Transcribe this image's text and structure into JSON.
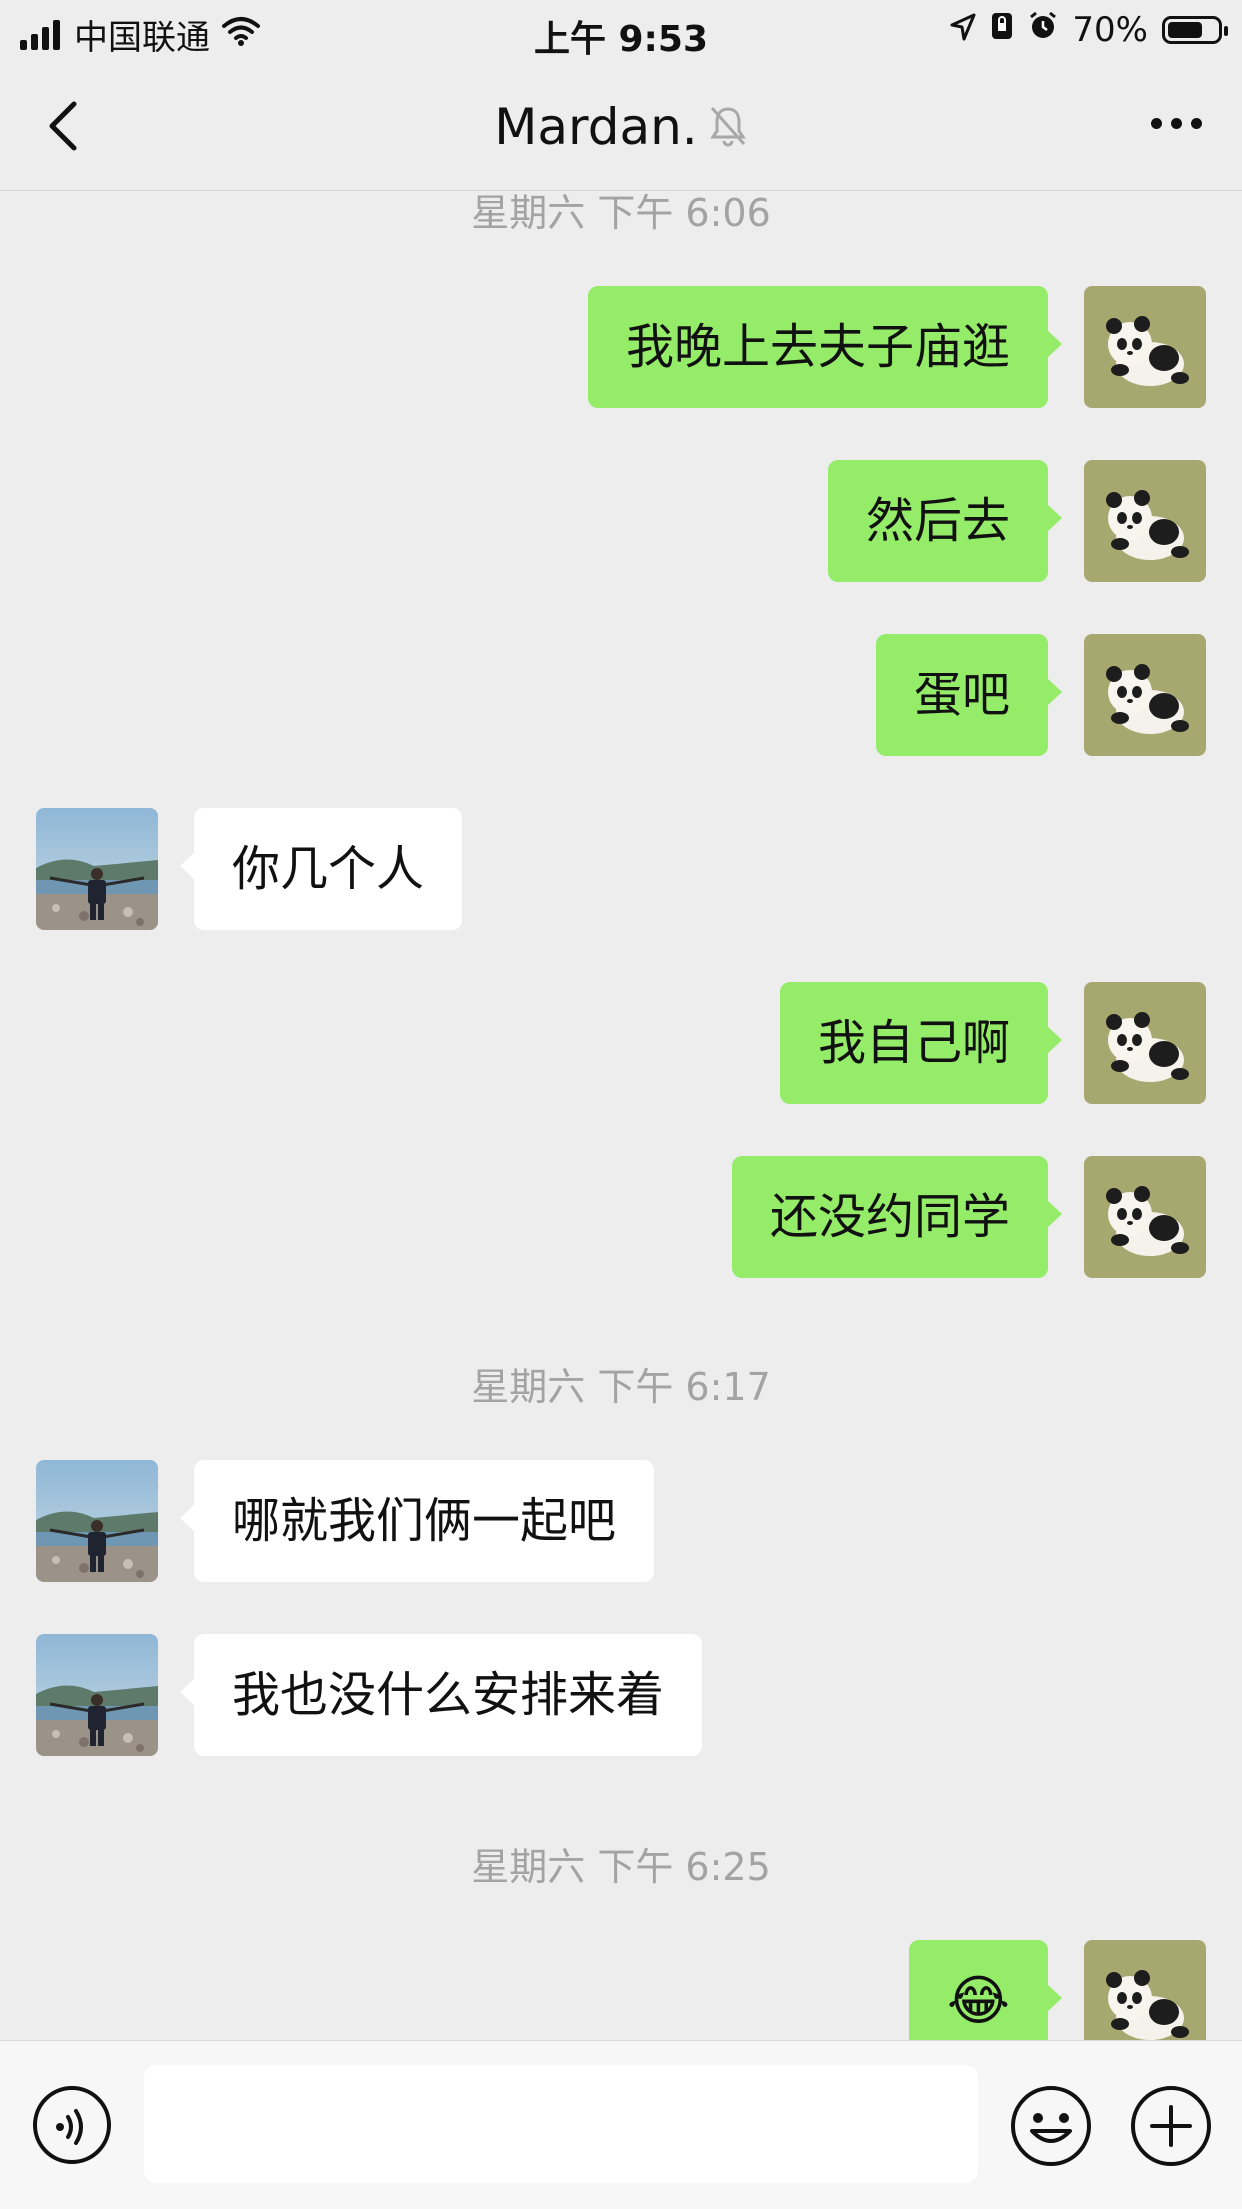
{
  "status_bar": {
    "carrier": "中国联通",
    "time": "上午 9:53",
    "battery": "70%",
    "battery_level": 0.7
  },
  "nav": {
    "title": "Mardan."
  },
  "messages": [
    {
      "text": "我晚上去夫子庙逛"
    },
    {
      "text": "然后去"
    },
    {
      "text": "蛋吧"
    },
    {
      "text": "你几个人"
    },
    {
      "text": "我自己啊"
    },
    {
      "text": "还没约同学"
    },
    {
      "text": "哪就我们俩一起吧"
    },
    {
      "text": "我也没什么安排来着"
    },
    {
      "text": "😂"
    }
  ],
  "timestamps": [
    "星期六 下午 6:06",
    "星期六 下午 6:17",
    "星期六 下午 6:25"
  ],
  "input": {
    "value": ""
  },
  "colors": {
    "outgoing_bubble": "#95ec69",
    "incoming_bubble": "#ffffff",
    "background": "#ededed"
  }
}
